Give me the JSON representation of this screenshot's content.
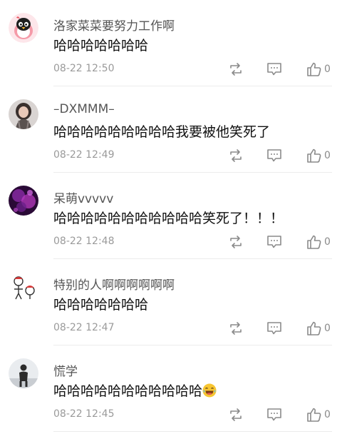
{
  "comments": [
    {
      "username": "洛家菜菜要努力工作啊",
      "text": "哈哈哈哈哈哈哈",
      "time": "08-22 12:50",
      "likes": "0",
      "avatar": "penguin-avatar"
    },
    {
      "username": "–DXMMM–",
      "text": "哈哈哈哈哈哈哈哈哈我要被他笑死了",
      "time": "08-22 12:49",
      "likes": "0",
      "avatar": "girl-photo-avatar"
    },
    {
      "username": "呆萌vvvvv",
      "text": "哈哈哈哈哈哈哈哈哈哈哈笑死了！！！",
      "time": "08-22 12:48",
      "likes": "0",
      "avatar": "purple-bokeh-avatar"
    },
    {
      "username": "特别的人啊啊啊啊啊啊",
      "text": "哈哈哈哈哈哈哈",
      "time": "08-22 12:47",
      "likes": "0",
      "avatar": "cartoon-sketch-avatar"
    },
    {
      "username": "慌学",
      "text": "哈哈哈哈哈哈哈哈哈哈哈",
      "time": "08-22 12:45",
      "likes": "0",
      "avatar": "person-standing-avatar",
      "emoji": "laughing-emoji"
    }
  ],
  "icons": {
    "repost": "repost-icon",
    "reply": "comment-icon",
    "like": "thumbs-up-icon"
  },
  "colors": {
    "meta": "#9a9a9a",
    "divider": "#ececec",
    "text": "#111111"
  }
}
